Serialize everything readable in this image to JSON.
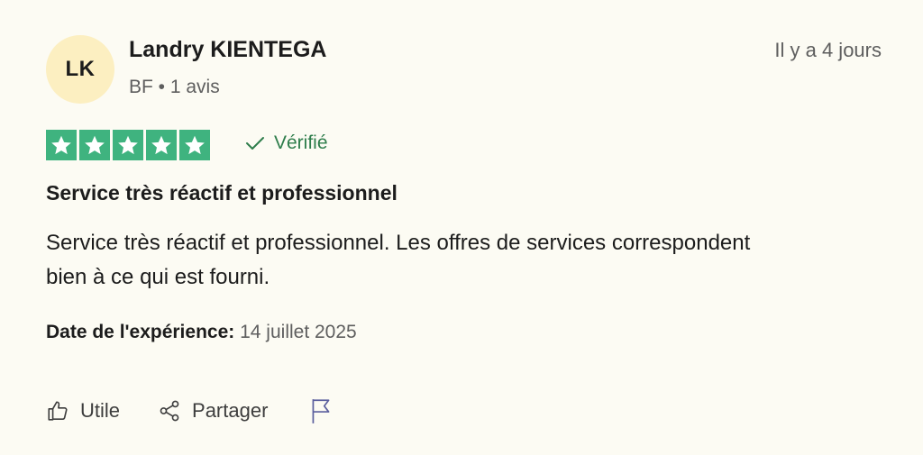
{
  "review": {
    "author": {
      "initials": "LK",
      "name": "Landry KIENTEGA",
      "meta": "BF • 1 avis"
    },
    "posted": "Il y a 4 jours",
    "rating": 5,
    "rating_color": "#3fb37f",
    "verified_label": "Vérifié",
    "verified_color": "#2e7d4b",
    "title": "Service très réactif et professionnel",
    "body": "Service très réactif et professionnel. Les offres de services correspondent bien à ce qui est fourni.",
    "experience": {
      "label": "Date de l'expérience:",
      "value": "14 juillet 2025"
    }
  },
  "actions": {
    "useful_label": "Utile",
    "share_label": "Partager",
    "report_icon": "flag-icon"
  }
}
